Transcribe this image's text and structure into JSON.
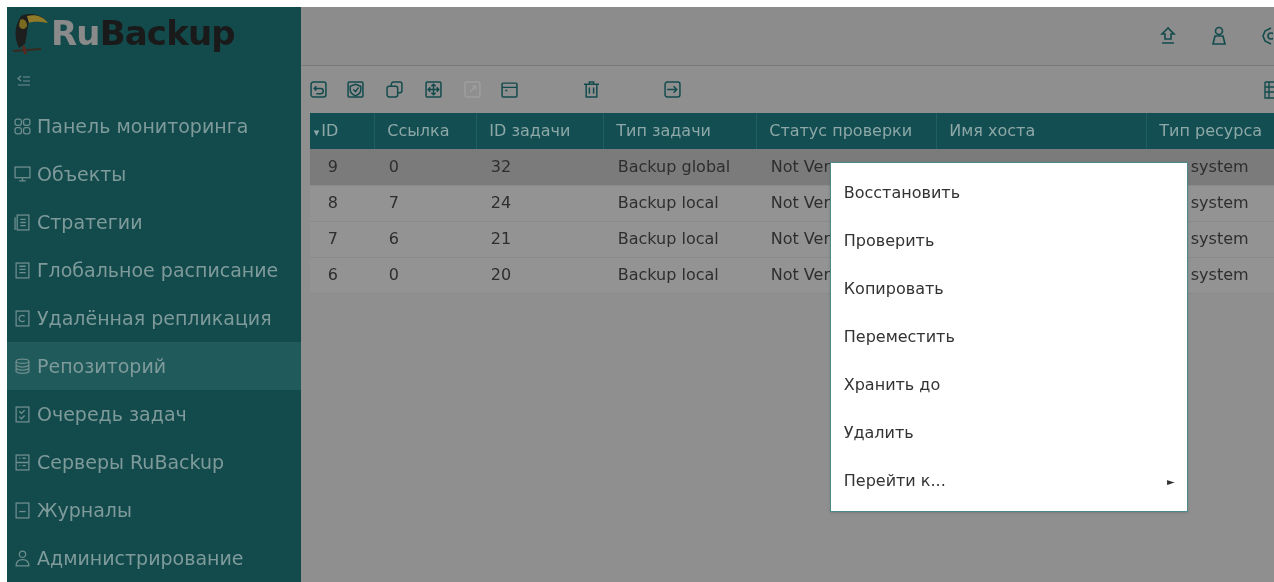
{
  "logo": {
    "part_1": "Ru",
    "part_2": "Backup"
  },
  "sidebar": {
    "items": [
      {
        "label": "Панель мониторинга",
        "selected": false
      },
      {
        "label": "Объекты",
        "selected": false
      },
      {
        "label": "Стратегии",
        "selected": false
      },
      {
        "label": "Глобальное расписание",
        "selected": false
      },
      {
        "label": "Удалённая репликация",
        "selected": false
      },
      {
        "label": "Репозиторий",
        "selected": true
      },
      {
        "label": "Очередь задач",
        "selected": false
      },
      {
        "label": "Серверы RuBackup",
        "selected": false
      },
      {
        "label": "Журналы",
        "selected": false
      },
      {
        "label": "Администрирование",
        "selected": false
      }
    ]
  },
  "toolbar": [
    {
      "disabled": false
    },
    {
      "disabled": false
    },
    {
      "disabled": false
    },
    {
      "disabled": false
    },
    {
      "disabled": true
    },
    {
      "disabled": false
    },
    {
      "disabled": false
    },
    {
      "disabled": false
    }
  ],
  "table": {
    "columns": [
      {
        "label": "ID",
        "sorted": true,
        "sort_mark": "▾"
      },
      {
        "label": "Ссылка",
        "sorted": false
      },
      {
        "label": "ID задачи",
        "sorted": false
      },
      {
        "label": "Тип задачи",
        "sorted": false
      },
      {
        "label": "Статус проверки",
        "sorted": false
      },
      {
        "label": "Имя хоста",
        "sorted": false
      },
      {
        "label": "Тип ресурса",
        "sorted": false
      }
    ],
    "rows": [
      {
        "selected": true,
        "cells": [
          "9",
          "0",
          "32",
          "Backup global",
          "Not Ver",
          "",
          "system"
        ]
      },
      {
        "selected": false,
        "cells": [
          "8",
          "7",
          "24",
          "Backup local",
          "Not Ver",
          "",
          "system"
        ]
      },
      {
        "selected": false,
        "cells": [
          "7",
          "6",
          "21",
          "Backup local",
          "Not Ver",
          "",
          "system"
        ]
      },
      {
        "selected": false,
        "cells": [
          "6",
          "0",
          "20",
          "Backup local",
          "Not Ver",
          "",
          "system"
        ]
      }
    ]
  },
  "context_menu": [
    {
      "label": "Восстановить",
      "kind": "action"
    },
    {
      "label": "Проверить",
      "kind": "action"
    },
    {
      "label": "Копировать",
      "kind": "action"
    },
    {
      "label": "Переместить",
      "kind": "action"
    },
    {
      "label": "Хранить до",
      "kind": "action"
    },
    {
      "label": "Удалить",
      "kind": "action"
    },
    {
      "label": "Перейти к...",
      "kind": "submenu",
      "arrow": "►"
    }
  ]
}
